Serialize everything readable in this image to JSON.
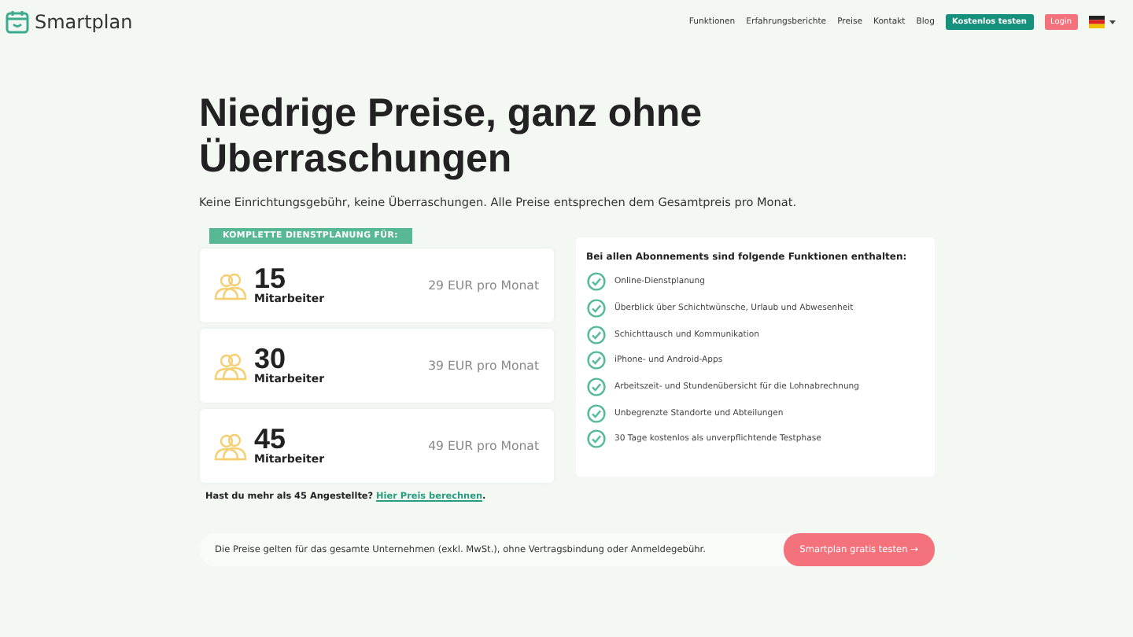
{
  "header": {
    "logo": "Smartplan",
    "nav": [
      "Funktionen",
      "Erfahrungsberichte",
      "Preise",
      "Kontakt",
      "Blog"
    ],
    "cta": "Kostenlos testen",
    "login": "Login"
  },
  "hero": {
    "title": "Niedrige Preise, ganz ohne Überraschungen",
    "subtitle": "Keine Einrichtungsgebühr, keine Überraschungen. Alle Preise entsprechen dem Gesamtpreis pro Monat."
  },
  "plans": {
    "badge": "KOMPLETTE DIENSTPLANUNG FÜR:",
    "items": [
      {
        "count": "15",
        "unit": "Mitarbeiter",
        "price": "29 EUR pro Monat"
      },
      {
        "count": "30",
        "unit": "Mitarbeiter",
        "price": "39 EUR pro Monat"
      },
      {
        "count": "45",
        "unit": "Mitarbeiter",
        "price": "49 EUR pro Monat"
      }
    ],
    "more": "Hast du mehr als 45 Angestellte?",
    "more_link": "Hier Preis berechnen",
    "more_end": "."
  },
  "features": {
    "title": "Bei allen Abonnements sind folgende Funktionen enthalten:",
    "items": [
      "Online-Dienstplanung",
      "Überblick über Schichtwünsche, Urlaub und Abwesenheit",
      "Schichttausch und Kommunikation",
      "iPhone- und Android-Apps",
      "Arbeitszeit- und Stundenübersicht für die Lohnabrechnung",
      "Unbegrenzte Standorte und Abteilungen",
      "30 Tage kostenlos als unverpflichtende Testphase"
    ]
  },
  "footer": {
    "note": "Die Preise gelten für das gesamte Unternehmen (exkl. MwSt.), ohne Vertragsbindung oder Anmeldegebühr.",
    "cta": "Smartplan gratis testen →"
  }
}
